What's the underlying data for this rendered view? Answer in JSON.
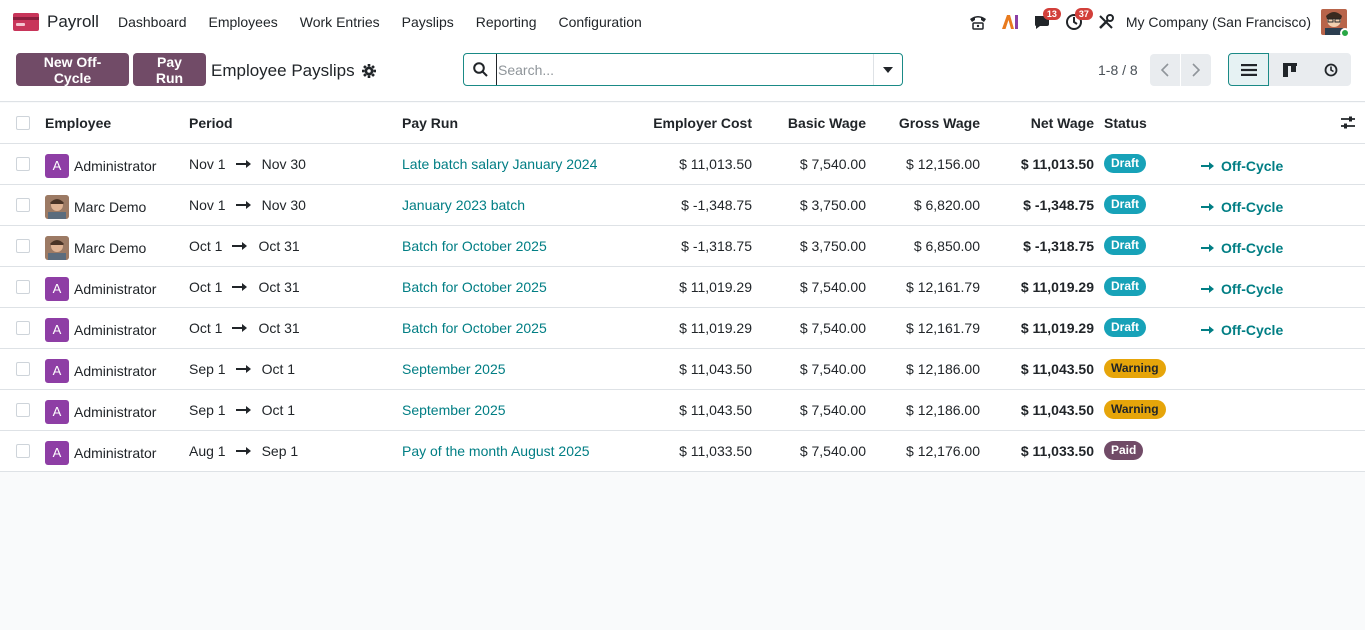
{
  "navbar": {
    "app_name": "Payroll",
    "menu": [
      "Dashboard",
      "Employees",
      "Work Entries",
      "Payslips",
      "Reporting",
      "Configuration"
    ],
    "messages_badge": "13",
    "activities_badge": "37",
    "company": "My Company (San Francisco)"
  },
  "control": {
    "new_offcycle_label": "New Off-Cycle",
    "payrun_label": "Pay Run",
    "title": "Employee Payslips",
    "search_placeholder": "Search...",
    "pager": "1-8 / 8"
  },
  "table": {
    "headers": {
      "employee": "Employee",
      "period": "Period",
      "pay_run": "Pay Run",
      "employer_cost": "Employer Cost",
      "basic_wage": "Basic Wage",
      "gross_wage": "Gross Wage",
      "net_wage": "Net Wage",
      "status": "Status"
    },
    "rows": [
      {
        "avatar": "A",
        "employee": "Administrator",
        "from": "Nov 1",
        "to": "Nov 30",
        "pay_run": "Late batch salary January 2024",
        "employer_cost": "$ 11,013.50",
        "basic": "$ 7,540.00",
        "gross": "$ 12,156.00",
        "net": "$ 11,013.50",
        "status": "Draft",
        "status_type": "info",
        "action": "Off-Cycle"
      },
      {
        "avatar": "photo",
        "employee": "Marc Demo",
        "from": "Nov 1",
        "to": "Nov 30",
        "pay_run": "January 2023 batch",
        "employer_cost": "$ -1,348.75",
        "basic": "$ 3,750.00",
        "gross": "$ 6,820.00",
        "net": "$ -1,348.75",
        "status": "Draft",
        "status_type": "info",
        "action": "Off-Cycle"
      },
      {
        "avatar": "photo",
        "employee": "Marc Demo",
        "from": "Oct 1",
        "to": "Oct 31",
        "pay_run": "Batch for October 2025",
        "employer_cost": "$ -1,318.75",
        "basic": "$ 3,750.00",
        "gross": "$ 6,850.00",
        "net": "$ -1,318.75",
        "status": "Draft",
        "status_type": "info",
        "action": "Off-Cycle"
      },
      {
        "avatar": "A",
        "employee": "Administrator",
        "from": "Oct 1",
        "to": "Oct 31",
        "pay_run": "Batch for October 2025",
        "employer_cost": "$ 11,019.29",
        "basic": "$ 7,540.00",
        "gross": "$ 12,161.79",
        "net": "$ 11,019.29",
        "status": "Draft",
        "status_type": "info",
        "action": "Off-Cycle"
      },
      {
        "avatar": "A",
        "employee": "Administrator",
        "from": "Oct 1",
        "to": "Oct 31",
        "pay_run": "Batch for October 2025",
        "employer_cost": "$ 11,019.29",
        "basic": "$ 7,540.00",
        "gross": "$ 12,161.79",
        "net": "$ 11,019.29",
        "status": "Draft",
        "status_type": "info",
        "action": "Off-Cycle"
      },
      {
        "avatar": "A",
        "employee": "Administrator",
        "from": "Sep 1",
        "to": "Oct 1",
        "pay_run": "September 2025",
        "employer_cost": "$ 11,043.50",
        "basic": "$ 7,540.00",
        "gross": "$ 12,186.00",
        "net": "$ 11,043.50",
        "status": "Warning",
        "status_type": "warning",
        "action": ""
      },
      {
        "avatar": "A",
        "employee": "Administrator",
        "from": "Sep 1",
        "to": "Oct 1",
        "pay_run": "September 2025",
        "employer_cost": "$ 11,043.50",
        "basic": "$ 7,540.00",
        "gross": "$ 12,186.00",
        "net": "$ 11,043.50",
        "status": "Warning",
        "status_type": "warning",
        "action": ""
      },
      {
        "avatar": "A",
        "employee": "Administrator",
        "from": "Aug 1",
        "to": "Sep 1",
        "pay_run": "Pay of the month August 2025",
        "employer_cost": "$ 11,033.50",
        "basic": "$ 7,540.00",
        "gross": "$ 12,176.00",
        "net": "$ 11,033.50",
        "status": "Paid",
        "status_type": "paid",
        "action": ""
      }
    ]
  },
  "colors": {
    "primary": "#714b67",
    "link": "#017e84",
    "draft_badge": "#17a2b8",
    "warning_badge": "#e6a50a",
    "notification_badge": "#d23f3a"
  }
}
